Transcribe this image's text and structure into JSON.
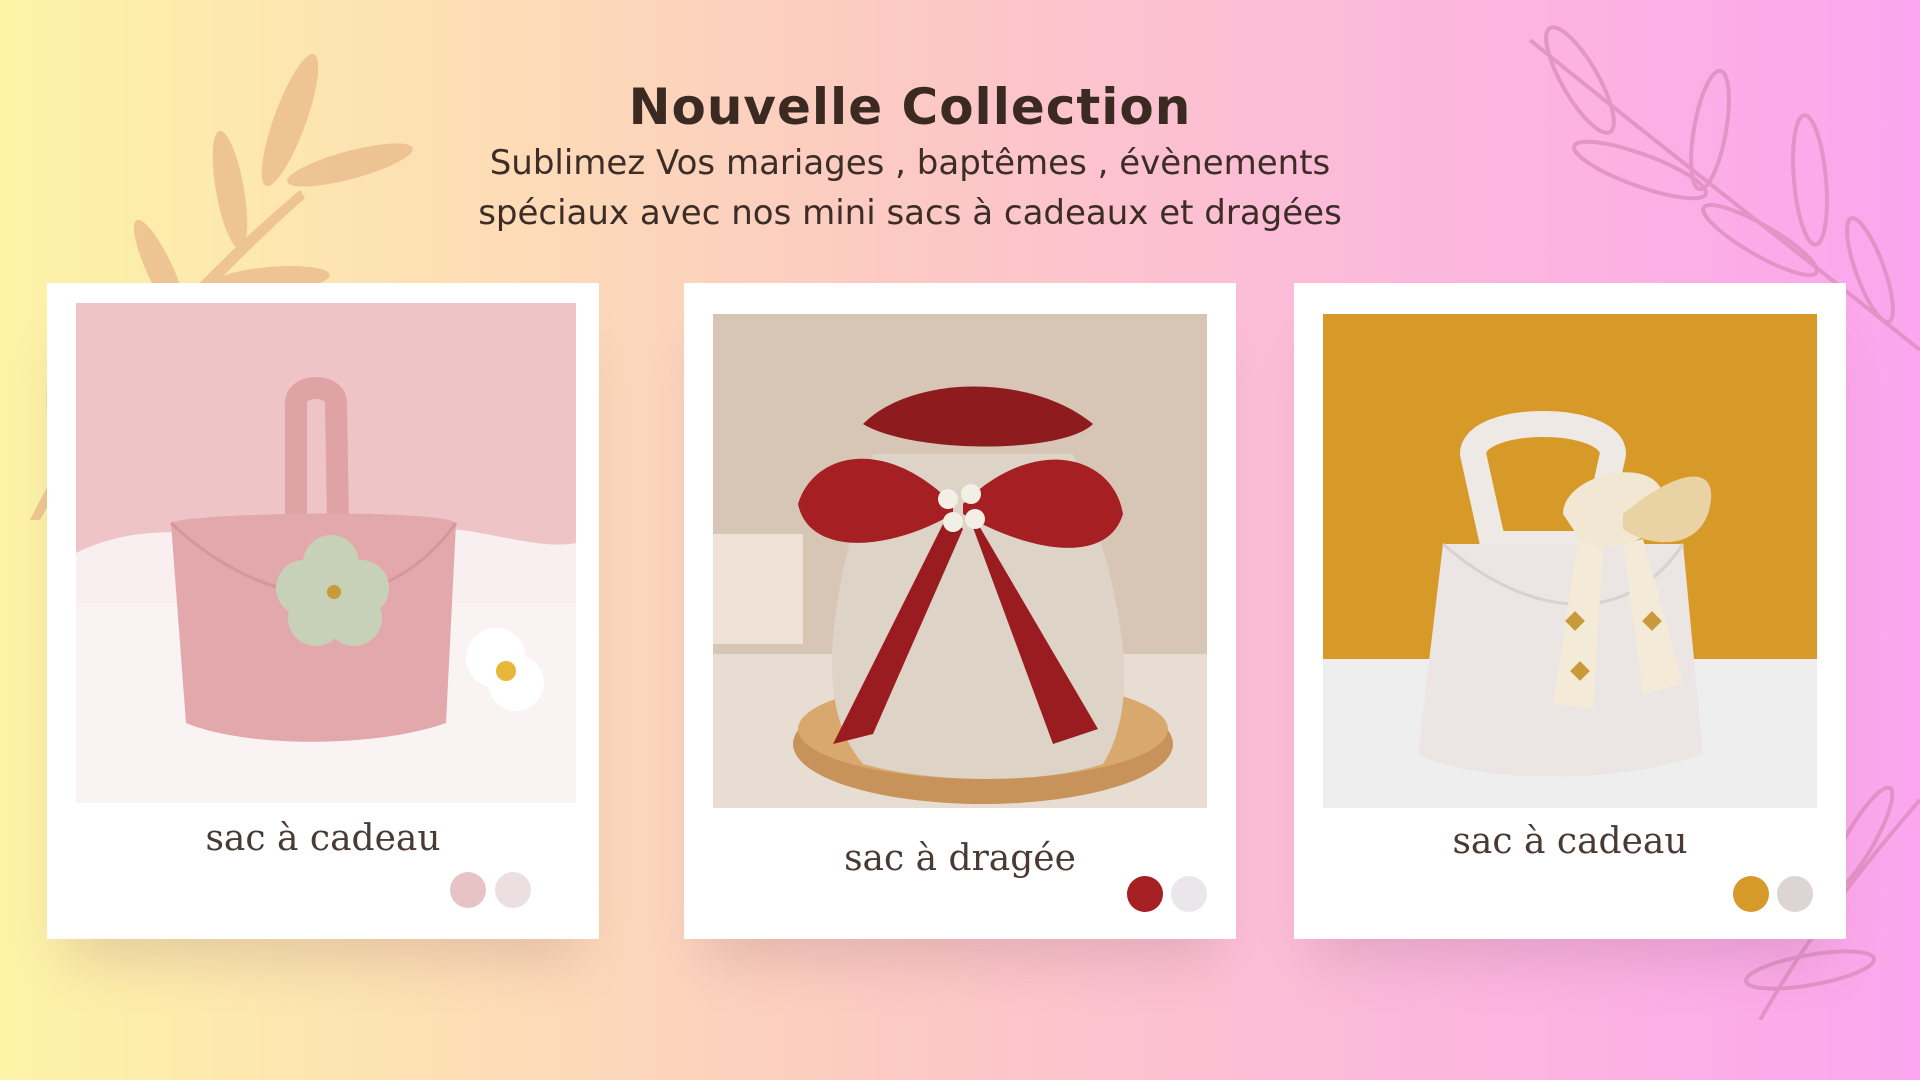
{
  "header": {
    "title": "Nouvelle Collection",
    "subtitle_line1": "Sublimez Vos mariages , baptêmes , évènements",
    "subtitle_line2": "spéciaux avec nos mini sacs à cadeaux et dragées"
  },
  "products": [
    {
      "name": "sac à cadeau",
      "image_icon": "pink-basket-bag-photo",
      "swatches": [
        "#e8c3c5",
        "#ebdfe2"
      ]
    },
    {
      "name": "sac à dragée",
      "image_icon": "satin-bow-pouch-photo",
      "swatches": [
        "#a51f23",
        "#ebe6ea"
      ]
    },
    {
      "name": "sac à cadeau",
      "image_icon": "white-scarf-bag-photo",
      "swatches": [
        "#d69a2a",
        "#dcd5d4"
      ]
    }
  ],
  "colors": {
    "title": "#3b2a22",
    "gradient_left": "#fdf3a6",
    "gradient_right": "#fba6ee"
  }
}
